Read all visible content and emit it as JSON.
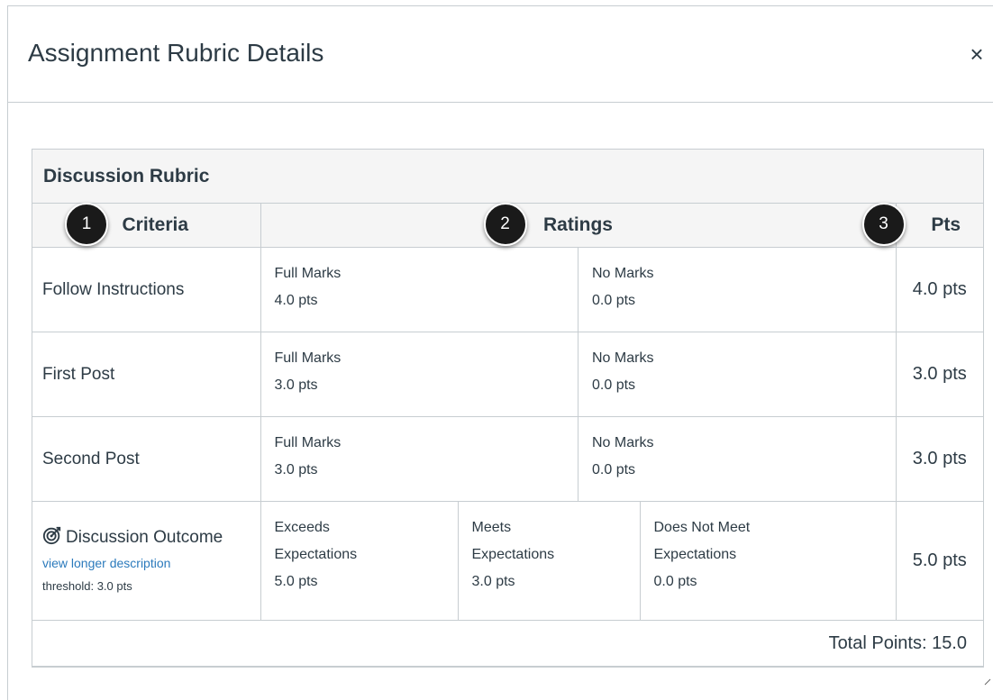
{
  "dialog": {
    "title": "Assignment Rubric Details",
    "close_glyph": "×"
  },
  "rubric": {
    "title": "Discussion Rubric",
    "headers": {
      "criteria": "Criteria",
      "ratings": "Ratings",
      "pts": "Pts"
    },
    "badges": [
      "1",
      "2",
      "3"
    ],
    "rows": [
      {
        "criterion": "Follow Instructions",
        "ratings": [
          {
            "label": "Full Marks",
            "points": "4.0 pts"
          },
          {
            "label": "No Marks",
            "points": "0.0 pts"
          }
        ],
        "points": "4.0 pts"
      },
      {
        "criterion": "First Post",
        "ratings": [
          {
            "label": "Full Marks",
            "points": "3.0 pts"
          },
          {
            "label": "No Marks",
            "points": "0.0 pts"
          }
        ],
        "points": "3.0 pts"
      },
      {
        "criterion": "Second Post",
        "ratings": [
          {
            "label": "Full Marks",
            "points": "3.0 pts"
          },
          {
            "label": "No Marks",
            "points": "0.0 pts"
          }
        ],
        "points": "3.0 pts"
      }
    ],
    "outcome": {
      "icon": "outcome-target-icon",
      "title": "Discussion Outcome",
      "link": "view longer description",
      "threshold": "threshold: 3.0 pts",
      "ratings": [
        {
          "label_line1": "Exceeds",
          "label_line2": "Expectations",
          "points": "5.0 pts"
        },
        {
          "label_line1": "Meets",
          "label_line2": "Expectations",
          "points": "3.0 pts"
        },
        {
          "label_line1": "Does Not Meet",
          "label_line2": "Expectations",
          "points": "0.0 pts"
        }
      ],
      "points": "5.0 pts"
    },
    "total": "Total Points: 15.0"
  },
  "colors": {
    "text": "#2d3b45",
    "border": "#c7cdd1",
    "header_bg": "#f5f5f5",
    "link": "#2b7abc",
    "badge_bg": "#1a1a1a"
  }
}
